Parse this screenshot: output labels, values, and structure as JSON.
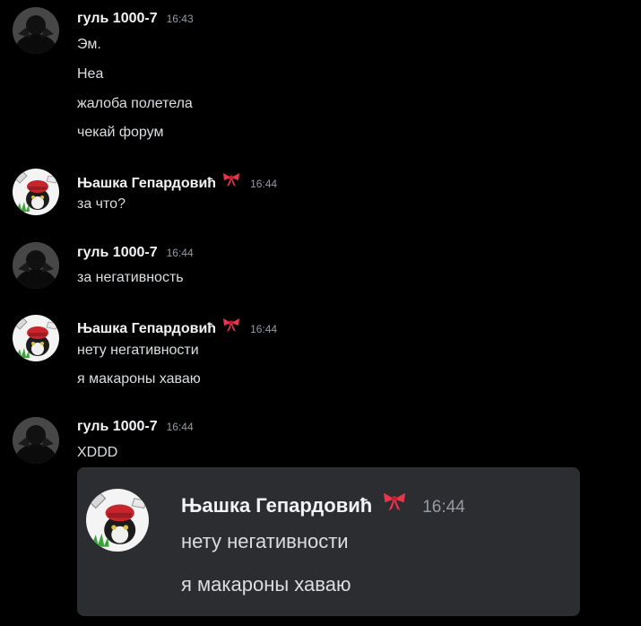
{
  "users": {
    "ghoul": {
      "name": "гуль 1000-7",
      "avatar_icon": "dark-hooded-figure-avatar"
    },
    "nyashka": {
      "name": "Њашка Гепардовић",
      "avatar_icon": "cat-with-red-hat-avatar",
      "badge_icon": "red-bow-icon"
    }
  },
  "messages": [
    {
      "author": "гуль 1000-7",
      "time": "16:43",
      "lines": [
        "Эм.",
        "Неа",
        "жалоба полетела",
        "чекай форум"
      ]
    },
    {
      "author": "Њашка Гепардовић",
      "time": "16:44",
      "lines": [
        "за что?"
      ]
    },
    {
      "author": "гуль 1000-7",
      "time": "16:44",
      "lines": [
        "за негативность"
      ]
    },
    {
      "author": "Њашка Гепардовић",
      "time": "16:44",
      "lines": [
        "нету негативности",
        "я макароны хаваю"
      ]
    },
    {
      "author": "гуль 1000-7",
      "time": "16:44",
      "lines": [
        "XDDD"
      ]
    }
  ],
  "embed": {
    "author": "Њашка Гепардовић",
    "time": "16:44",
    "lines": [
      "нету негативности",
      "я макароны хаваю"
    ]
  },
  "colors": {
    "background": "#000000",
    "embed_background": "#2b2d31",
    "author": "#f2f3f5",
    "text": "#dbdee1",
    "timestamp": "#949ba4",
    "bow": "#e8354a"
  }
}
